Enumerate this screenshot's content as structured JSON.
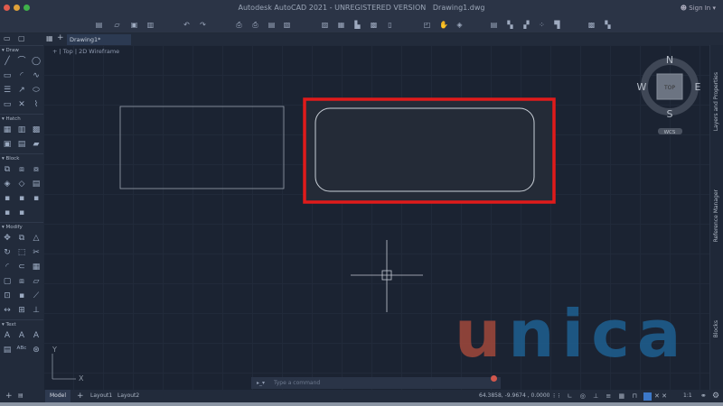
{
  "window": {
    "title": "Autodesk AutoCAD 2021 - UNREGISTERED VERSION",
    "filename": "Drawing1.dwg",
    "sign_in": "Sign In"
  },
  "tabs": {
    "active": "Drawing1*"
  },
  "viewport": {
    "label": "[-] [Top] [2D Wireframe]",
    "plus": "+",
    "view": "Top",
    "style": "2D Wireframe"
  },
  "viewcube": {
    "n": "N",
    "s": "S",
    "e": "E",
    "w": "W",
    "face": "TOP",
    "wcs": "WCS"
  },
  "left_panel": {
    "sections": [
      {
        "title": "Draw",
        "icons": [
          "line",
          "polyline",
          "circle",
          "rectangle",
          "arc",
          "spline",
          "hatch-lines",
          "dimension",
          "ellipse",
          "rect-badge",
          "xline",
          "revcloud"
        ]
      },
      {
        "title": "Hatch",
        "icons": [
          "hatch",
          "gradient",
          "boundary",
          "region",
          "fill",
          "wipeout"
        ]
      },
      {
        "title": "Block",
        "icons": [
          "insert",
          "create",
          "edit",
          "attdef",
          "attribute",
          "write",
          "block-a",
          "block-b",
          "block-c",
          "block-d",
          "block-e"
        ]
      },
      {
        "title": "Modify",
        "icons": [
          "move",
          "copy",
          "mirror",
          "rotate",
          "stretch",
          "trim",
          "fillet",
          "offset",
          "array",
          "scale",
          "explode",
          "erase",
          "break",
          "join",
          "edit-badge",
          "lengthen",
          "align",
          "brush"
        ]
      },
      {
        "title": "Text",
        "icons": [
          "mtext",
          "text-style",
          "text",
          "field",
          "spell",
          "find"
        ]
      }
    ]
  },
  "right_panel": {
    "items": [
      "Layers and Properties",
      "Reference Manager",
      "Blocks"
    ]
  },
  "command": {
    "placeholder": "Type a command"
  },
  "status": {
    "layouts": [
      "Model",
      "Layout1",
      "Layout2"
    ],
    "coords": "64.3858, -9.9674 , 0.0000",
    "scale": "1:1"
  },
  "axes": {
    "x": "X",
    "y": "Y"
  },
  "watermark": {
    "text": "unica",
    "colors": [
      "#a0483b",
      "#1e5f90"
    ]
  },
  "colors": {
    "highlight": "#e01b1b",
    "canvas": "#1b2332"
  }
}
